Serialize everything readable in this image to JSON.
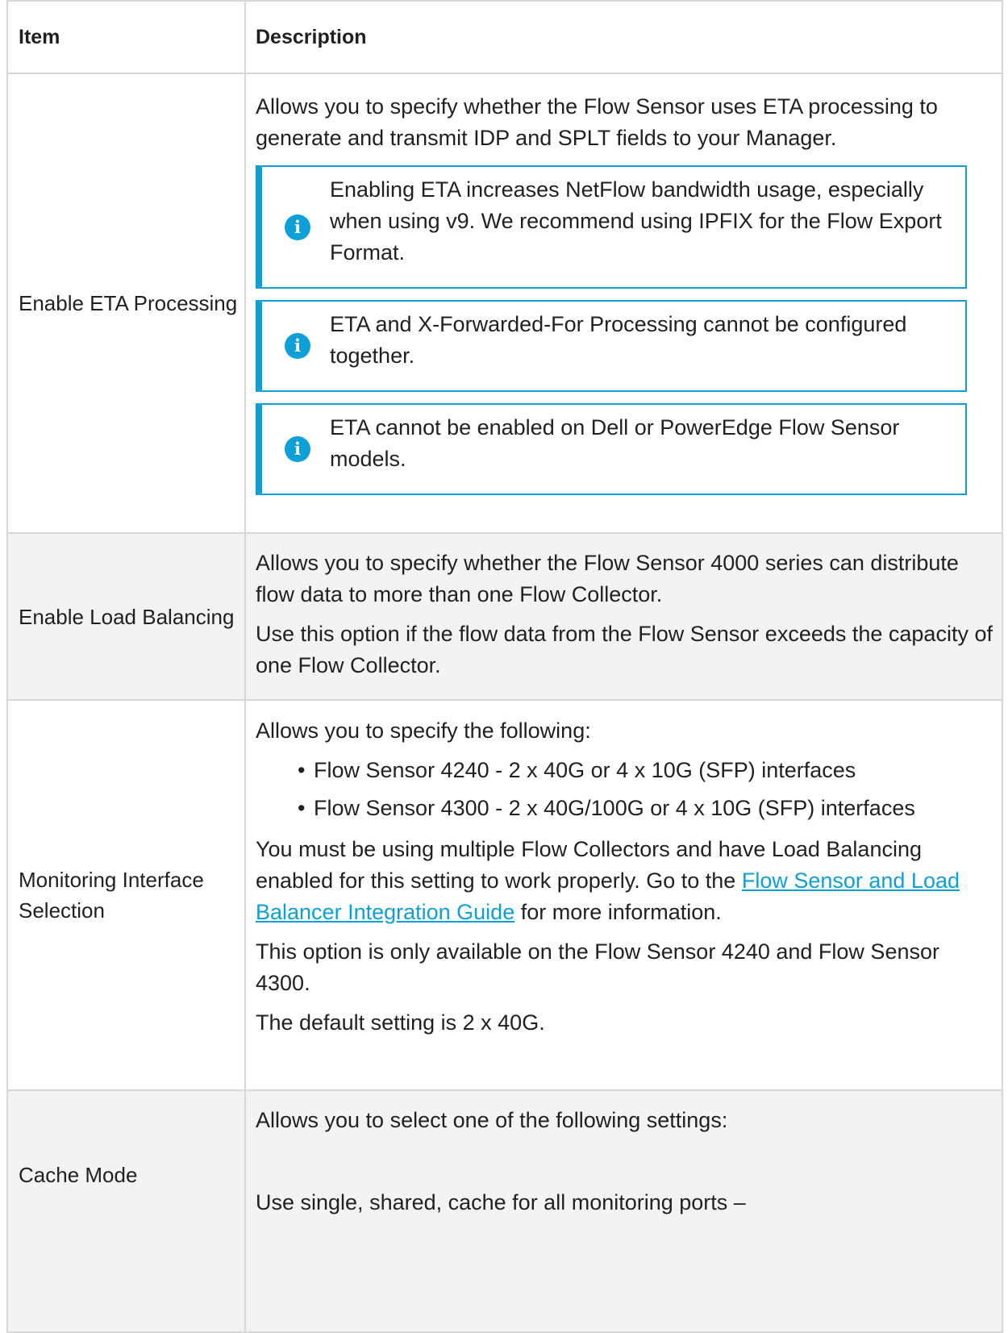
{
  "table": {
    "headers": {
      "item": "Item",
      "description": "Description"
    },
    "rows": {
      "eta": {
        "item": "Enable ETA Processing",
        "desc": "Allows you to specify whether the Flow Sensor uses ETA processing to generate and transmit IDP and SPLT fields to your Manager.",
        "notes": [
          "Enabling ETA increases NetFlow bandwidth usage, especially when using v9. We recommend using IPFIX for the Flow Export Format.",
          "ETA and X-Forwarded-For Processing cannot be configured together.",
          "ETA cannot be enabled on Dell or PowerEdge Flow Sensor models."
        ]
      },
      "load_balancing": {
        "item": "Enable Load Balancing",
        "desc1": "Allows you to specify whether the Flow Sensor 4000 series can distribute flow data to more than one Flow Collector.",
        "desc2": "Use this option if the flow data from the Flow Sensor exceeds the capacity of one Flow Collector."
      },
      "monitoring": {
        "item": "Monitoring Interface Selection",
        "intro": "Allows you to specify the following:",
        "bullets": [
          "Flow Sensor 4240 - 2 x 40G or 4 x 10G (SFP) interfaces",
          "Flow Sensor 4300 - 2 x 40G/100G or 4 x 10G (SFP) interfaces"
        ],
        "p2_before": "You must be using multiple Flow Collectors and have Load Balancing enabled for this setting to work properly. Go to the ",
        "p2_link": "Flow Sensor and Load Balancer Integration Guide",
        "p2_after": " for more information.",
        "p3": "This option is only available on the Flow Sensor 4240 and Flow Sensor 4300.",
        "p4": "The default setting is 2 x 40G."
      },
      "cache": {
        "item": "Cache Mode",
        "desc1": "Allows you to select one of the following settings:",
        "desc2": "Use single, shared, cache for all monitoring ports –"
      }
    }
  },
  "colors": {
    "accent": "#0d9fd8",
    "border": "#d7d7d7",
    "shaded_row": "#f3f3f3"
  },
  "icons": {
    "note": "info-icon"
  }
}
